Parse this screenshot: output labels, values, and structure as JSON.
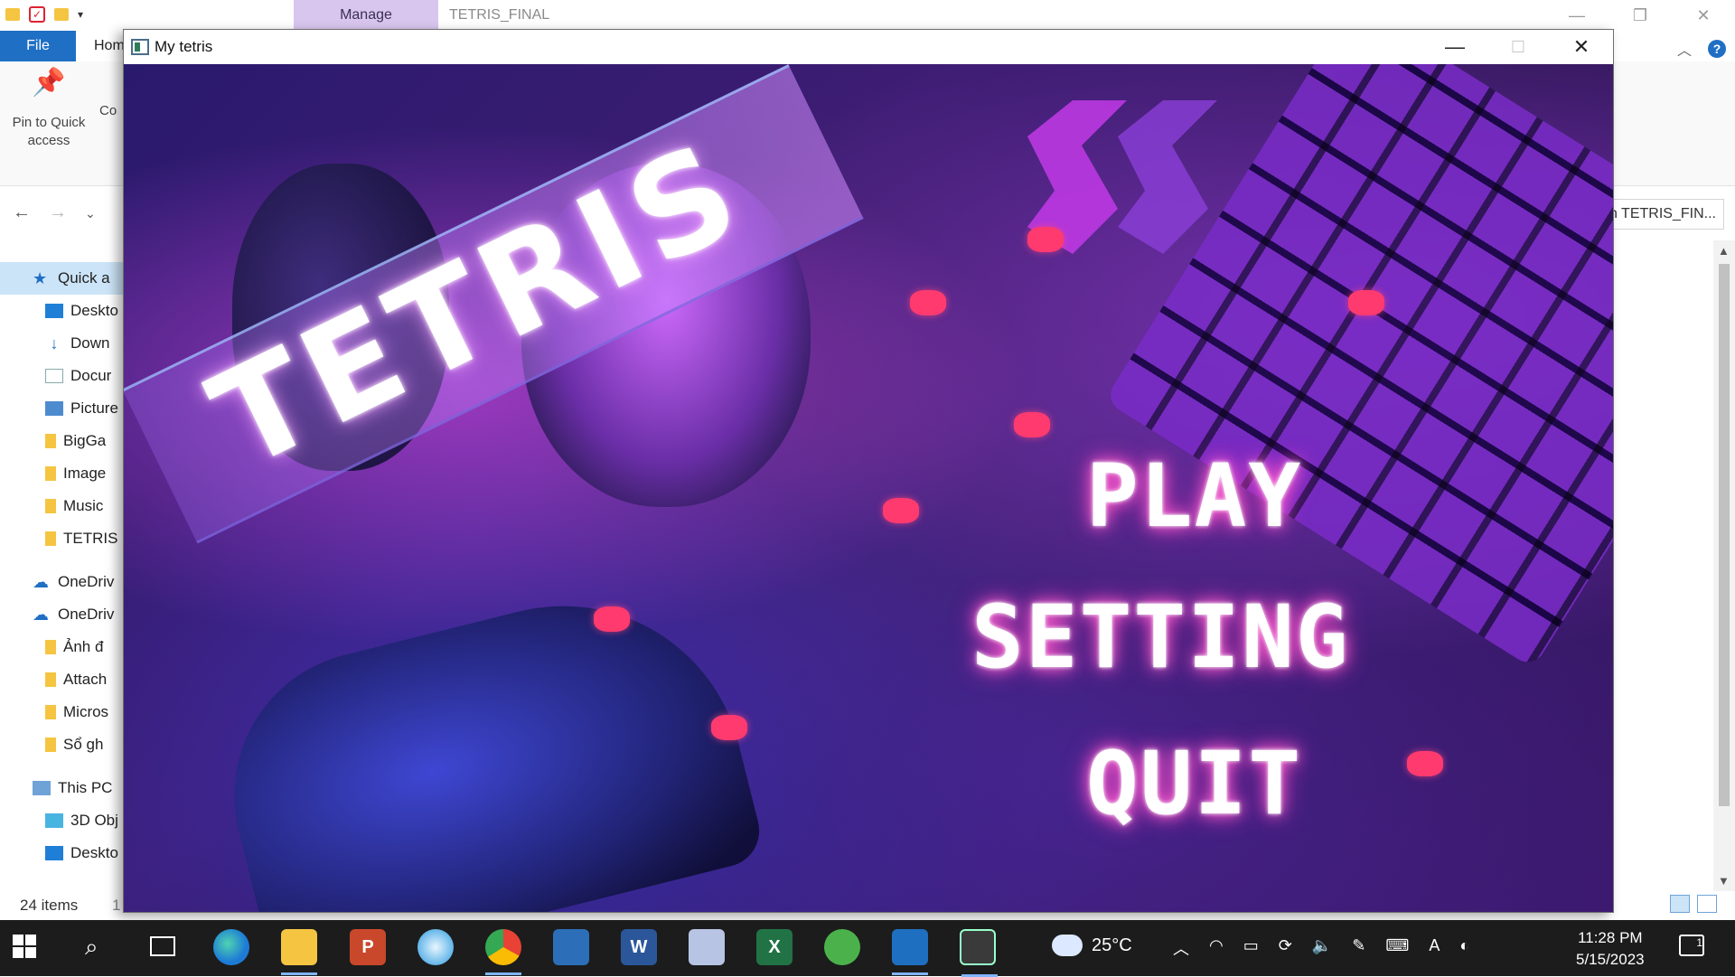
{
  "explorer": {
    "title": "TETRIS_FINAL",
    "manage_tab": "Manage",
    "file_tab": "File",
    "home_tab": "Hom",
    "pin_label": "Pin to Quick access",
    "copy_stub": "Co",
    "search_placeholder": "h TETRIS_FIN...",
    "sidebar": [
      {
        "label": "Quick a",
        "icon": "star-icon",
        "selected": true
      },
      {
        "label": "Deskto",
        "icon": "desktop-icon"
      },
      {
        "label": "Down",
        "icon": "download-icon"
      },
      {
        "label": "Docur",
        "icon": "document-icon"
      },
      {
        "label": "Picture",
        "icon": "pictures-icon"
      },
      {
        "label": "BigGa",
        "icon": "folder-icon"
      },
      {
        "label": "Image",
        "icon": "folder-icon"
      },
      {
        "label": "Music",
        "icon": "folder-icon"
      },
      {
        "label": "TETRIS",
        "icon": "folder-icon"
      },
      {
        "label": "OneDriv",
        "icon": "cloud-icon"
      },
      {
        "label": "OneDriv",
        "icon": "cloud-icon"
      },
      {
        "label": "Ảnh đ",
        "icon": "folder-icon"
      },
      {
        "label": "Attach",
        "icon": "folder-icon"
      },
      {
        "label": "Micros",
        "icon": "folder-icon"
      },
      {
        "label": "Sổ gh",
        "icon": "folder-icon"
      },
      {
        "label": "This PC",
        "icon": "pc-icon"
      },
      {
        "label": "3D Obj",
        "icon": "3d-objects-icon"
      },
      {
        "label": "Deskto",
        "icon": "desktop-icon"
      }
    ],
    "status_items": "24 items",
    "status_sep": "1"
  },
  "game": {
    "window_title": "My tetris",
    "logo": "TETRIS",
    "menu": {
      "play": "PLAY",
      "setting": "SETTING",
      "quit": "QUIT"
    }
  },
  "taskbar": {
    "weather": "25°C",
    "time": "11:28 PM",
    "date": "5/15/2023",
    "notifications": "1",
    "apps": [
      "edge",
      "file-explorer",
      "powerpoint",
      "pen",
      "chrome",
      "photos",
      "word",
      "game",
      "excel",
      "graduation",
      "vscode",
      "tetris"
    ]
  },
  "colors": {
    "accent": "#1f6fc5",
    "manage_tab": "#d9c6ef",
    "neon_pink": "#ff3ac0",
    "taskbar": "#1c1c1c"
  }
}
